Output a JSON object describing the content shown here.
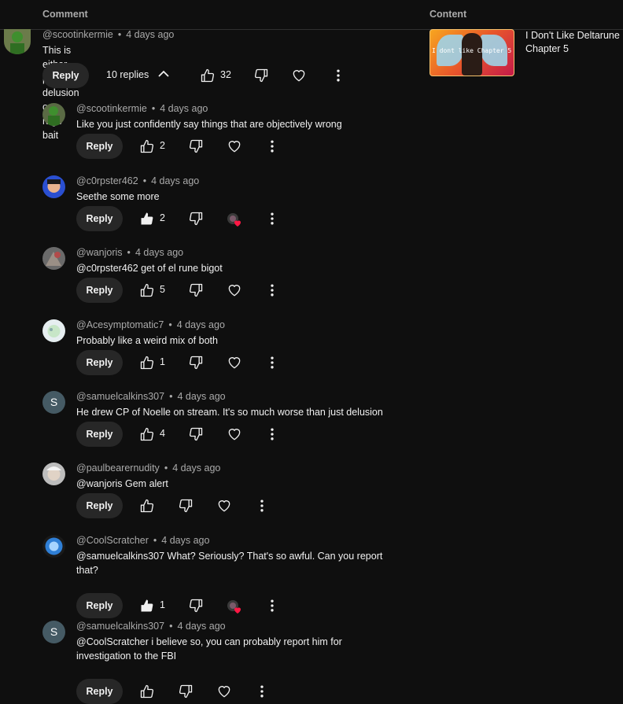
{
  "columns": {
    "comment": "Comment",
    "content": "Content"
  },
  "video": {
    "title": "I Don't Like Deltarune Chapter 5",
    "thumbnail_caption": "I dont like Chapter 5"
  },
  "top_comment": {
    "author": "@scootinkermie",
    "time": "4 days ago",
    "text": "This is either pure delusion or a rage bait",
    "reply_label": "Reply",
    "replies_label": "10 replies",
    "likes": "32"
  },
  "replies": [
    {
      "author": "@scootinkermie",
      "time": "4 days ago",
      "text": "Like you just confidently say things that are objectively wrong",
      "reply_label": "Reply",
      "likes": "2",
      "liked": false,
      "hearted": false,
      "avatar": "frog"
    },
    {
      "author": "@c0rpster462",
      "time": "4 days ago",
      "text": "Seethe some more",
      "reply_label": "Reply",
      "likes": "2",
      "liked": true,
      "hearted": true,
      "avatar": "blue"
    },
    {
      "author": "@wanjoris",
      "time": "4 days ago",
      "text": "@c0rpster462  get of el rune bigot",
      "reply_label": "Reply",
      "likes": "5",
      "liked": false,
      "hearted": false,
      "avatar": "grey"
    },
    {
      "author": "@Acesymptomatic7",
      "time": "4 days ago",
      "text": "Probably like a weird mix of both",
      "reply_label": "Reply",
      "likes": "1",
      "liked": false,
      "hearted": false,
      "avatar": "light"
    },
    {
      "author": "@samuelcalkins307",
      "time": "4 days ago",
      "text": "He drew CP of Noelle on stream. It's so much worse than just delusion",
      "reply_label": "Reply",
      "likes": "4",
      "liked": false,
      "hearted": false,
      "avatar": "S"
    },
    {
      "author": "@paulbearernudity",
      "time": "4 days ago",
      "text": "@wanjoris Gem alert",
      "reply_label": "Reply",
      "likes": "",
      "liked": false,
      "hearted": false,
      "avatar": "einstein"
    },
    {
      "author": "@CoolScratcher",
      "time": "4 days ago",
      "text": "@samuelcalkins307 What? Seriously? That's so awful. Can you report that?",
      "reply_label": "Reply",
      "likes": "1",
      "liked": true,
      "hearted": true,
      "avatar": "scratch"
    },
    {
      "author": "@samuelcalkins307",
      "time": "4 days ago",
      "text": "@CoolScratcher i believe so, you can probably report him for investigation to the FBI",
      "reply_label": "Reply",
      "likes": "",
      "liked": false,
      "hearted": false,
      "avatar": "S"
    }
  ],
  "icons": {
    "thumb_up": "thumb-up-icon",
    "thumb_down": "thumb-down-icon",
    "heart": "heart-icon",
    "more": "more-vert-icon",
    "chevron": "chevron-up-icon"
  }
}
